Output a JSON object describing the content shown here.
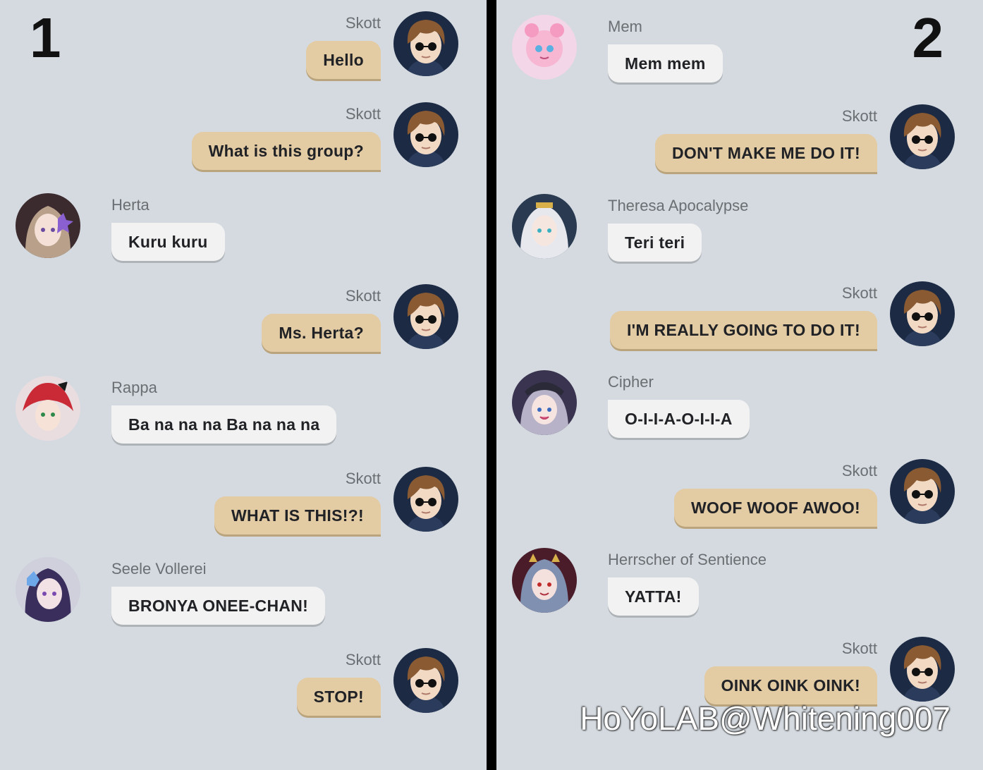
{
  "panels": [
    {
      "number": "1",
      "messages": [
        {
          "side": "right",
          "sender": "Skott",
          "text": "Hello",
          "avatar": "skott-avatar"
        },
        {
          "side": "right",
          "sender": "Skott",
          "text": "What is this group?",
          "avatar": "skott-avatar"
        },
        {
          "side": "left",
          "sender": "Herta",
          "text": "Kuru kuru",
          "avatar": "herta-avatar"
        },
        {
          "side": "right",
          "sender": "Skott",
          "text": "Ms. Herta?",
          "avatar": "skott-avatar"
        },
        {
          "side": "left",
          "sender": "Rappa",
          "text": "Ba na na na Ba na na na",
          "avatar": "rappa-avatar"
        },
        {
          "side": "right",
          "sender": "Skott",
          "text": "WHAT IS THIS!?!",
          "avatar": "skott-avatar"
        },
        {
          "side": "left",
          "sender": "Seele Vollerei",
          "text": "BRONYA ONEE-CHAN!",
          "avatar": "seele-avatar"
        },
        {
          "side": "right",
          "sender": "Skott",
          "text": "STOP!",
          "avatar": "skott-avatar"
        }
      ]
    },
    {
      "number": "2",
      "messages": [
        {
          "side": "left",
          "sender": "Mem",
          "text": "Mem mem",
          "avatar": "mem-avatar"
        },
        {
          "side": "right",
          "sender": "Skott",
          "text": "DON'T MAKE ME DO IT!",
          "avatar": "skott-avatar"
        },
        {
          "side": "left",
          "sender": "Theresa Apocalypse",
          "text": "Teri teri",
          "avatar": "theresa-avatar"
        },
        {
          "side": "right",
          "sender": "Skott",
          "text": "I'M REALLY GOING TO DO IT!",
          "avatar": "skott-avatar"
        },
        {
          "side": "left",
          "sender": "Cipher",
          "text": "O-I-I-A-O-I-I-A",
          "avatar": "cipher-avatar"
        },
        {
          "side": "right",
          "sender": "Skott",
          "text": "WOOF WOOF AWOO!",
          "avatar": "skott-avatar"
        },
        {
          "side": "left",
          "sender": "Herrscher of Sentience",
          "text": "YATTA!",
          "avatar": "herrscher-avatar"
        },
        {
          "side": "right",
          "sender": "Skott",
          "text": "OINK OINK OINK!",
          "avatar": "skott-avatar"
        }
      ]
    }
  ],
  "watermark": "HoYoLAB@Whitening007",
  "colors": {
    "panel_bg": "#d4dae0",
    "divider": "#000000",
    "outgoing_bubble": "#e3cba3",
    "incoming_bubble": "#f2f2f2",
    "sender_text": "#6b6e72"
  }
}
